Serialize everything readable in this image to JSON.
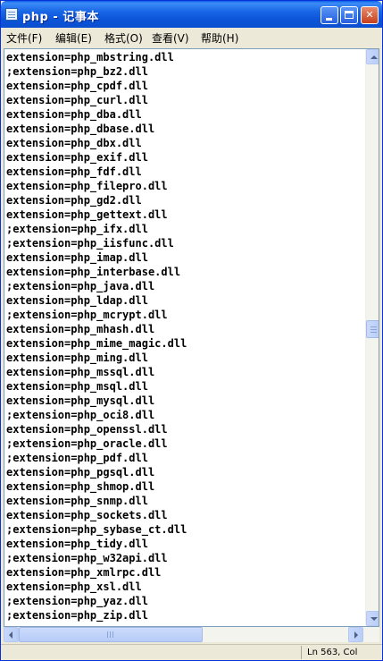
{
  "window": {
    "title": "php - 记事本",
    "controls": {
      "minimize": "minimize",
      "maximize": "maximize",
      "close": "✕"
    }
  },
  "menu": [
    {
      "label": "文件(F)"
    },
    {
      "label": "编辑(E)"
    },
    {
      "label": "格式(O)"
    },
    {
      "label": "查看(V)"
    },
    {
      "label": "帮助(H)"
    }
  ],
  "editor": {
    "lines": [
      "extension=php_mbstring.dll",
      ";extension=php_bz2.dll",
      "extension=php_cpdf.dll",
      "extension=php_curl.dll",
      "extension=php_dba.dll",
      "extension=php_dbase.dll",
      "extension=php_dbx.dll",
      "extension=php_exif.dll",
      "extension=php_fdf.dll",
      "extension=php_filepro.dll",
      "extension=php_gd2.dll",
      "extension=php_gettext.dll",
      ";extension=php_ifx.dll",
      ";extension=php_iisfunc.dll",
      "extension=php_imap.dll",
      "extension=php_interbase.dll",
      ";extension=php_java.dll",
      "extension=php_ldap.dll",
      ";extension=php_mcrypt.dll",
      "extension=php_mhash.dll",
      "extension=php_mime_magic.dll",
      "extension=php_ming.dll",
      "extension=php_mssql.dll",
      "extension=php_msql.dll",
      "extension=php_mysql.dll",
      ";extension=php_oci8.dll",
      "extension=php_openssl.dll",
      ";extension=php_oracle.dll",
      ";extension=php_pdf.dll",
      "extension=php_pgsql.dll",
      "extension=php_shmop.dll",
      "extension=php_snmp.dll",
      "extension=php_sockets.dll",
      ";extension=php_sybase_ct.dll",
      "extension=php_tidy.dll",
      ";extension=php_w32api.dll",
      "extension=php_xmlrpc.dll",
      "extension=php_xsl.dll",
      ";extension=php_yaz.dll",
      ";extension=php_zip.dll"
    ]
  },
  "status": {
    "position": "Ln 563, Col"
  },
  "colors": {
    "titlebar": "#0c54d8",
    "window_bg": "#ece9d8",
    "scrollbar": "#b8cdf6"
  }
}
